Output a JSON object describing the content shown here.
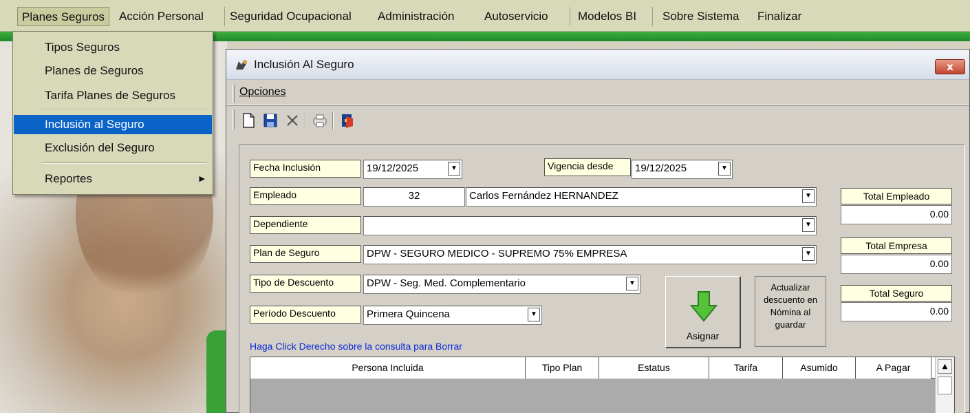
{
  "menubar": {
    "items": [
      "Planes Seguros",
      "Acción Personal",
      "Seguridad Ocupacional",
      "Administración",
      "Autoservicio",
      "Modelos BI",
      "Sobre Sistema",
      "Finalizar"
    ]
  },
  "dropdown": {
    "items": [
      "Tipos Seguros",
      "Planes de Seguros",
      "Tarifa Planes de Seguros",
      "Inclusión al Seguro",
      "Exclusión del Seguro",
      "Reportes"
    ],
    "submenu_arrow": "▶"
  },
  "window": {
    "title": "Inclusión Al Seguro",
    "close_label": "x",
    "menu_opciones": "Opciones"
  },
  "toolbar": {
    "icons": [
      "new-document-icon",
      "save-icon",
      "delete-icon",
      "print-icon",
      "exit-icon"
    ]
  },
  "form": {
    "fecha_inclusion_label": "Fecha Inclusión",
    "fecha_inclusion_value": "19/12/2025",
    "vigencia_label": "Vigencia desde",
    "vigencia_value": "19/12/2025",
    "empleado_label": "Empleado",
    "empleado_code": "32",
    "empleado_name": "Carlos Fernández HERNANDEZ",
    "dependiente_label": "Dependiente",
    "dependiente_value": "",
    "plan_label": "Plan de Seguro",
    "plan_value": "DPW - SEGURO MEDICO - SUPREMO 75% EMPRESA",
    "tipo_desc_label": "Tipo de Descuento",
    "tipo_desc_value": "DPW - Seg. Med. Complementario",
    "periodo_label": "Período Descuento",
    "periodo_value": "Primera Quincena",
    "hint": "Haga Click Derecho sobre la consulta para Borrar",
    "dropdown_arrow": "▼"
  },
  "totals": {
    "empleado_label": "Total Empleado",
    "empleado_value": "0.00",
    "empresa_label": "Total Empresa",
    "empresa_value": "0.00",
    "seguro_label": "Total Seguro",
    "seguro_value": "0.00"
  },
  "buttons": {
    "asignar": "Asignar",
    "actualizar": "Actualizar descuento en Nómina al guardar"
  },
  "grid": {
    "columns": [
      "Persona Incluida",
      "Tipo Plan",
      "Estatus",
      "Tarifa",
      "Asumido",
      "A Pagar"
    ],
    "scroll_up": "▲"
  }
}
